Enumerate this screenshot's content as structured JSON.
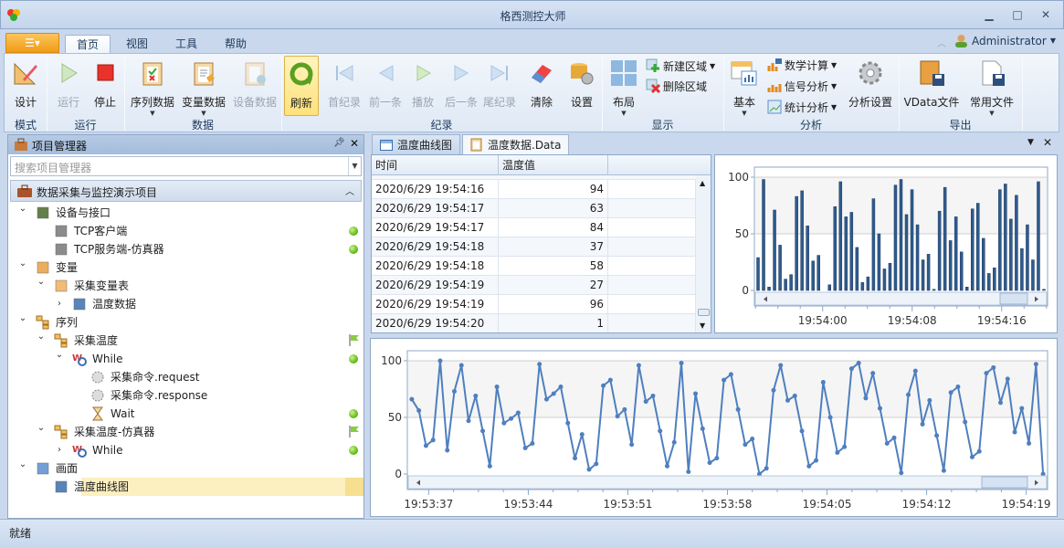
{
  "window": {
    "title": "格西测控大师",
    "minimize": "▭",
    "restore": "□",
    "close": "✕"
  },
  "menu": {
    "app_button_icon": "document-menu-icon",
    "tabs": [
      "首页",
      "视图",
      "工具",
      "帮助"
    ],
    "active_tab": "首页",
    "user": "Administrator"
  },
  "ribbon": {
    "groups": [
      "模式",
      "运行",
      "数据",
      "纪录",
      "显示",
      "分析",
      "导出"
    ],
    "buttons": {
      "design": "设计",
      "run": "运行",
      "stop": "停止",
      "seq_data": "序列数据",
      "var_data": "变量数据",
      "dev_data": "设备数据",
      "refresh": "刷新",
      "first": "首纪录",
      "prev": "前一条",
      "play": "播放",
      "next": "后一条",
      "last": "尾纪录",
      "clear": "清除",
      "settings": "设置",
      "layout": "布局",
      "new_area": "新建区域",
      "delete_area": "删除区域",
      "basic": "基本",
      "math": "数学计算",
      "signal": "信号分析",
      "stats": "统计分析",
      "analysis_settings": "分析设置",
      "vdata_file": "VData文件",
      "common_file": "常用文件"
    }
  },
  "project_panel": {
    "title": "项目管理器",
    "search_placeholder": "搜索项目管理器",
    "project_name": "数据采集与监控演示项目",
    "tree": [
      {
        "label": "设备与接口",
        "level": 0,
        "expanded": true,
        "icon": "device-card-icon"
      },
      {
        "label": "TCP客户端",
        "level": 1,
        "icon": "network-port-icon",
        "status": "ok"
      },
      {
        "label": "TCP服务端-仿真器",
        "level": 1,
        "icon": "network-port-icon",
        "status": "ok"
      },
      {
        "label": "变量",
        "level": 0,
        "expanded": true,
        "icon": "variables-icon"
      },
      {
        "label": "采集变量表",
        "level": 1,
        "expanded": true,
        "icon": "variable-table-icon"
      },
      {
        "label": "温度数据",
        "level": 2,
        "expanded": false,
        "icon": "data-table-icon"
      },
      {
        "label": "序列",
        "level": 0,
        "expanded": true,
        "icon": "sequence-icon"
      },
      {
        "label": "采集温度",
        "level": 1,
        "expanded": true,
        "icon": "sequence-icon",
        "status": "flag"
      },
      {
        "label": "While",
        "level": 2,
        "expanded": true,
        "icon": "while-loop-icon",
        "status": "ok"
      },
      {
        "label": "采集命令.request",
        "level": 3,
        "icon": "command-gear-icon"
      },
      {
        "label": "采集命令.response",
        "level": 3,
        "icon": "command-gear-icon"
      },
      {
        "label": "Wait",
        "level": 3,
        "icon": "hourglass-icon",
        "status": "ok"
      },
      {
        "label": "采集温度-仿真器",
        "level": 1,
        "expanded": true,
        "icon": "sequence-icon",
        "status": "flag"
      },
      {
        "label": "While",
        "level": 2,
        "expanded": false,
        "icon": "while-loop-icon",
        "status": "ok"
      },
      {
        "label": "画面",
        "level": 0,
        "expanded": true,
        "icon": "screen-icon"
      },
      {
        "label": "温度曲线图",
        "level": 1,
        "icon": "window-icon",
        "selected": true
      }
    ]
  },
  "document_tabs": [
    {
      "label": "温度曲线图",
      "icon": "window-icon"
    },
    {
      "label": "温度数据.Data",
      "icon": "clipboard-icon",
      "active": true
    }
  ],
  "data_table": {
    "columns": [
      "时间",
      "温度值"
    ],
    "rows": [
      [
        "2020/6/29 19:54:16",
        "94"
      ],
      [
        "2020/6/29 19:54:17",
        "63"
      ],
      [
        "2020/6/29 19:54:17",
        "84"
      ],
      [
        "2020/6/29 19:54:18",
        "37"
      ],
      [
        "2020/6/29 19:54:18",
        "58"
      ],
      [
        "2020/6/29 19:54:19",
        "27"
      ],
      [
        "2020/6/29 19:54:19",
        "96"
      ],
      [
        "2020/6/29 19:54:20",
        "1"
      ]
    ]
  },
  "status": {
    "text": "就绪"
  },
  "colors": {
    "accent": "#f29b17",
    "bar": "#2f5b8e",
    "line": "#4f7fbf",
    "status_ok": "#58b410",
    "selection": "#fcefc0"
  },
  "chart_data": [
    {
      "type": "bar",
      "ylim": [
        0,
        100
      ],
      "yticks": [
        "0",
        "50",
        "100"
      ],
      "x_range": [
        "19:53:53.9",
        "19:54:20.1"
      ],
      "xticks": [
        "19:54:00",
        "19:54:08",
        "19:54:16"
      ],
      "grid": true,
      "values": [
        29,
        98,
        3,
        71,
        40,
        10,
        14,
        83,
        88,
        57,
        26,
        31,
        0,
        5,
        74,
        96,
        65,
        69,
        38,
        7,
        12,
        81,
        50,
        19,
        24,
        93,
        98,
        67,
        89,
        58,
        27,
        32,
        1,
        70,
        91,
        44,
        65,
        34,
        3,
        72,
        77,
        46,
        15,
        20,
        89,
        94,
        63,
        84,
        37,
        58,
        27,
        96,
        1
      ]
    },
    {
      "type": "line",
      "ylim": [
        0,
        100
      ],
      "yticks": [
        "0",
        "50",
        "100"
      ],
      "x_range": [
        "19:53:35.5",
        "19:54:20.5"
      ],
      "xticks": [
        "19:53:37",
        "19:53:44",
        "19:53:51",
        "19:53:58",
        "19:54:05",
        "19:54:12",
        "19:54:19"
      ],
      "grid": true,
      "values": [
        66,
        56,
        25,
        30,
        100,
        21,
        73,
        96,
        47,
        69,
        38,
        7,
        77,
        45,
        49,
        54,
        23,
        27,
        97,
        66,
        71,
        77,
        45,
        14,
        35,
        4,
        9,
        78,
        83,
        51,
        57,
        26,
        96,
        64,
        69,
        38,
        7,
        28,
        98,
        2,
        71,
        40,
        10,
        14,
        83,
        88,
        57,
        26,
        31,
        0,
        5,
        74,
        96,
        65,
        69,
        38,
        7,
        12,
        81,
        50,
        19,
        24,
        93,
        98,
        67,
        89,
        58,
        27,
        32,
        1,
        70,
        91,
        44,
        65,
        34,
        3,
        72,
        77,
        46,
        15,
        20,
        89,
        94,
        63,
        84,
        37,
        58,
        27,
        97,
        0
      ]
    }
  ]
}
